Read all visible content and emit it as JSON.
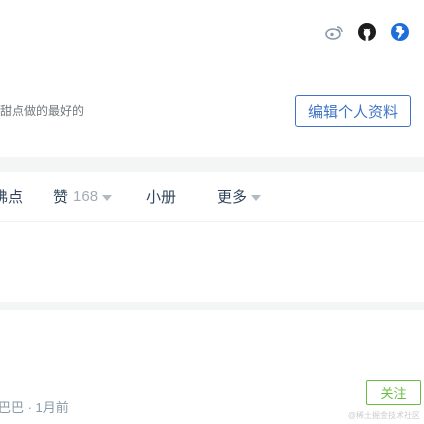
{
  "profile": {
    "bio": "甜点做的最好的",
    "edit_button": "编辑个人资料",
    "social_icons": [
      "weibo-icon",
      "github-icon",
      "globe-icon"
    ]
  },
  "tabs": [
    {
      "label": "沸点"
    },
    {
      "label": "赞",
      "count": "168",
      "has_dropdown": true
    },
    {
      "label": "小册"
    },
    {
      "label": "更多",
      "has_dropdown": true
    }
  ],
  "feed": {
    "meta": "巴巴 · 1月前",
    "follow_button": "关注",
    "watermark": "@稀土掘金技术社区"
  },
  "colors": {
    "accent_blue": "#3f73c7",
    "follow_green": "#6cbd45",
    "text_primary": "#31445b",
    "text_muted": "#72777b",
    "background": "#f4f5f5"
  }
}
